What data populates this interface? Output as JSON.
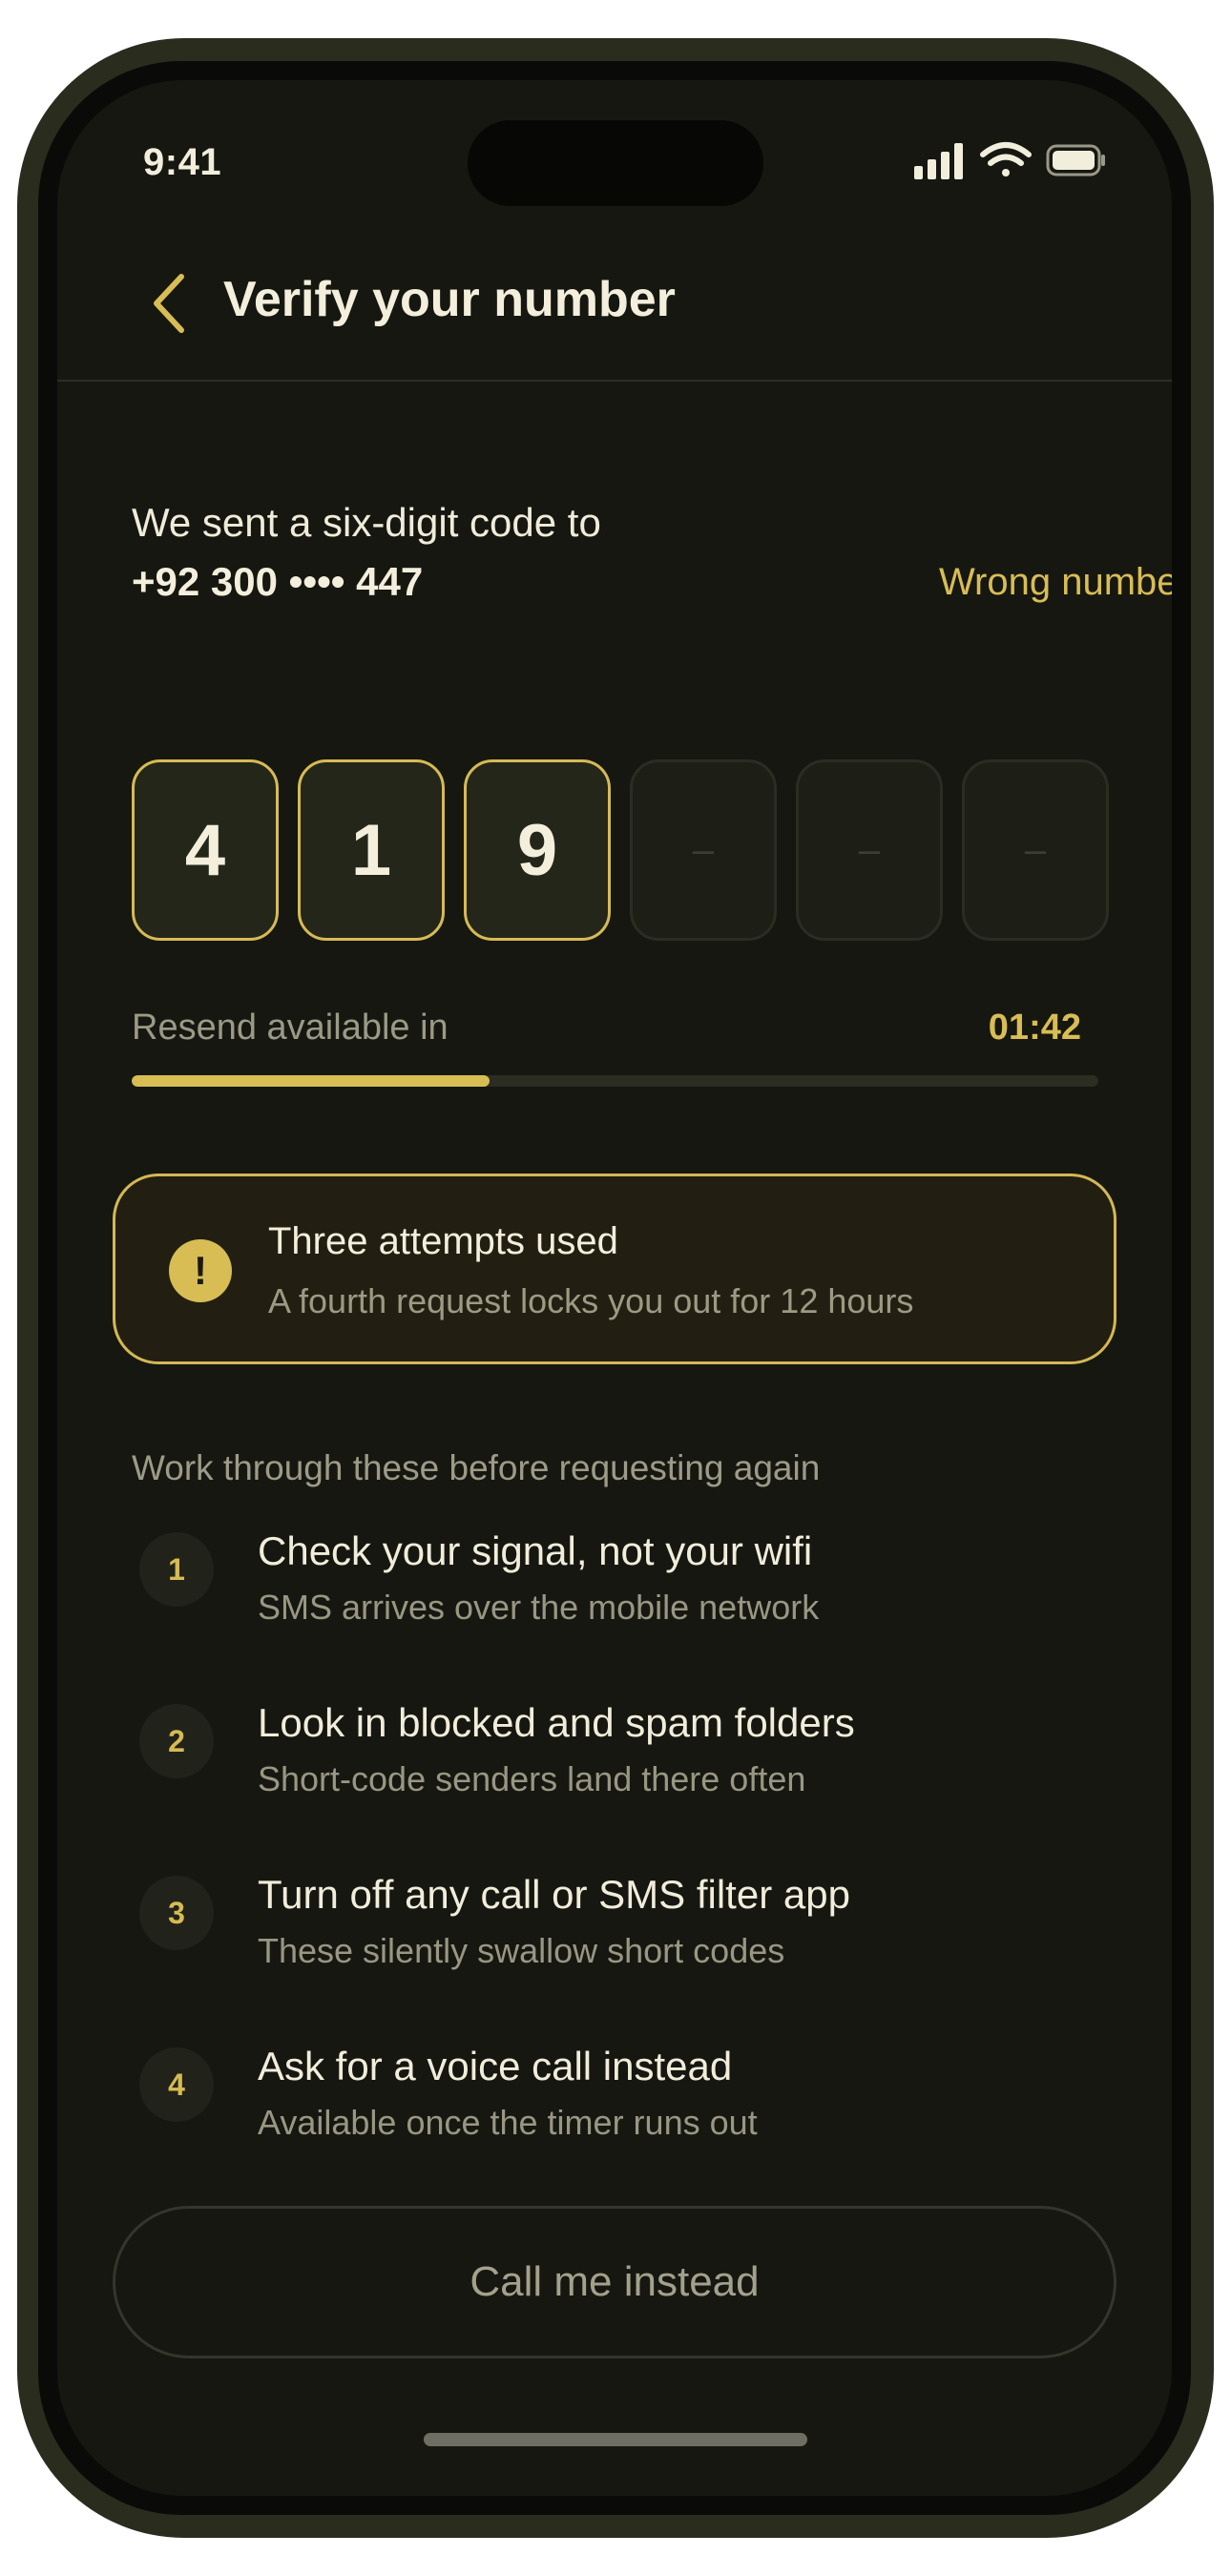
{
  "status_bar": {
    "time": "9:41",
    "icons": [
      "signal-icon",
      "wifi-icon",
      "battery-icon"
    ]
  },
  "nav": {
    "title": "Verify your number",
    "back_icon": "chevron-left-icon"
  },
  "intro": {
    "sent_text": "We sent a six-digit code to",
    "phone": "+92 300 •••• 447",
    "wrong_link": "Wrong numbe"
  },
  "otp": {
    "digits": [
      "4",
      "1",
      "9",
      "–",
      "–",
      "–"
    ]
  },
  "resend": {
    "label": "Resend available in",
    "timer": "01:42",
    "progress": 0.37
  },
  "warning": {
    "icon_glyph": "!",
    "title": "Three attempts used",
    "subtitle": "A fourth request locks you out for 12 hours"
  },
  "tips": {
    "label": "Work through these before requesting again",
    "steps": [
      {
        "num": "1",
        "title": "Check your signal, not your wifi",
        "subtitle": "SMS arrives over the mobile network"
      },
      {
        "num": "2",
        "title": "Look in blocked and spam folders",
        "subtitle": "Short-code senders land there often"
      },
      {
        "num": "3",
        "title": "Turn off any call or SMS filter app",
        "subtitle": "These silently swallow short codes"
      },
      {
        "num": "4",
        "title": "Ask for a voice call instead",
        "subtitle": "Available once the timer runs out"
      }
    ]
  },
  "actions": {
    "call_label": "Call me instead"
  },
  "colors": {
    "accent": "#d8bd55",
    "background": "#161710",
    "text": "#f3efdc",
    "muted": "#9d9b87"
  }
}
